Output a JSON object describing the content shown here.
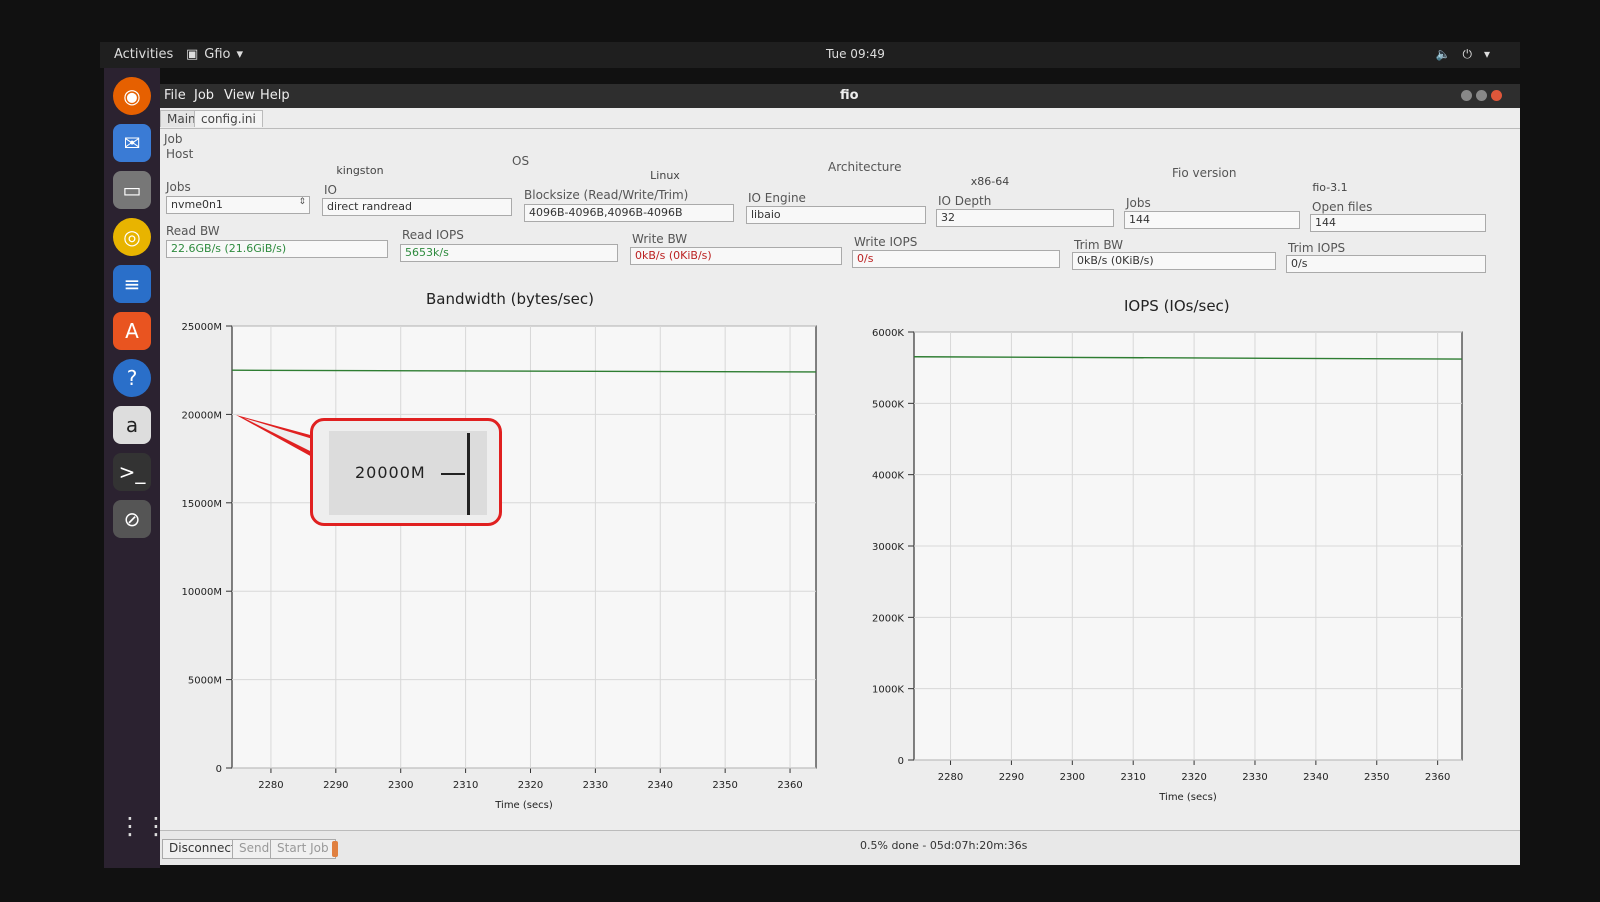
{
  "topbar": {
    "activities": "Activities",
    "app_menu": "Gfio",
    "clock": "Tue 09:49"
  },
  "window": {
    "title": "fio",
    "menu": [
      "File",
      "Job",
      "View",
      "Help"
    ]
  },
  "tabs": [
    "Main",
    "config.ini"
  ],
  "job": {
    "section_label": "Job",
    "host_label": "Host",
    "host": "kingston",
    "os_label": "OS",
    "os": "Linux",
    "arch_label": "Architecture",
    "arch": "x86-64",
    "fio_version_label": "Fio version",
    "fio_version": "fio-3.1",
    "jobs_select_label": "Jobs",
    "jobs_select": "nvme0n1",
    "io_label": "IO",
    "io": "direct randread",
    "blocksize_label": "Blocksize (Read/Write/Trim)",
    "blocksize": "4096B-4096B,4096B-4096B",
    "io_engine_label": "IO Engine",
    "io_engine": "libaio",
    "io_depth_label": "IO Depth",
    "io_depth": "32",
    "jobs_label": "Jobs",
    "jobs": "144",
    "open_files_label": "Open files",
    "open_files": "144",
    "read_bw_label": "Read BW",
    "read_bw": "22.6GB/s (21.6GiB/s)",
    "read_iops_label": "Read IOPS",
    "read_iops": "5653k/s",
    "write_bw_label": "Write BW",
    "write_bw": "0kB/s (0KiB/s)",
    "write_iops_label": "Write IOPS",
    "write_iops": "0/s",
    "trim_bw_label": "Trim BW",
    "trim_bw": "0kB/s (0KiB/s)",
    "trim_iops_label": "Trim IOPS",
    "trim_iops": "0/s"
  },
  "callout": {
    "text": "20000M"
  },
  "chart_data": [
    {
      "type": "line",
      "title": "Bandwidth (bytes/sec)",
      "xlabel": "Time (secs)",
      "ylabel": "",
      "xlim": [
        2274,
        2364
      ],
      "ylim": [
        0,
        25000
      ],
      "xticks": [
        2280,
        2290,
        2300,
        2310,
        2320,
        2330,
        2340,
        2350,
        2360
      ],
      "yticks": [
        0,
        5000,
        10000,
        15000,
        20000,
        25000
      ],
      "ytick_labels": [
        "0",
        "5000M",
        "10000M",
        "15000M",
        "20000M",
        "25000M"
      ],
      "grid": true,
      "series": [
        {
          "x": [
            2274,
            2364
          ],
          "y": [
            22500,
            22400
          ],
          "color": "#2e7d32"
        }
      ]
    },
    {
      "type": "line",
      "title": "IOPS (IOs/sec)",
      "xlabel": "Time (secs)",
      "ylabel": "",
      "xlim": [
        2274,
        2364
      ],
      "ylim": [
        0,
        6000
      ],
      "xticks": [
        2280,
        2290,
        2300,
        2310,
        2320,
        2330,
        2340,
        2350,
        2360
      ],
      "yticks": [
        0,
        1000,
        2000,
        3000,
        4000,
        5000,
        6000
      ],
      "ytick_labels": [
        "0",
        "1000K",
        "2000K",
        "3000K",
        "4000K",
        "5000K",
        "6000K"
      ],
      "grid": true,
      "series": [
        {
          "x": [
            2274,
            2364
          ],
          "y": [
            5653,
            5620
          ],
          "color": "#2e7d32"
        }
      ]
    }
  ],
  "bottom": {
    "disconnect": "Disconnect",
    "send": "Send",
    "start_job": "Start Job",
    "progress": "0.5% done - 05d:07h:20m:36s"
  }
}
